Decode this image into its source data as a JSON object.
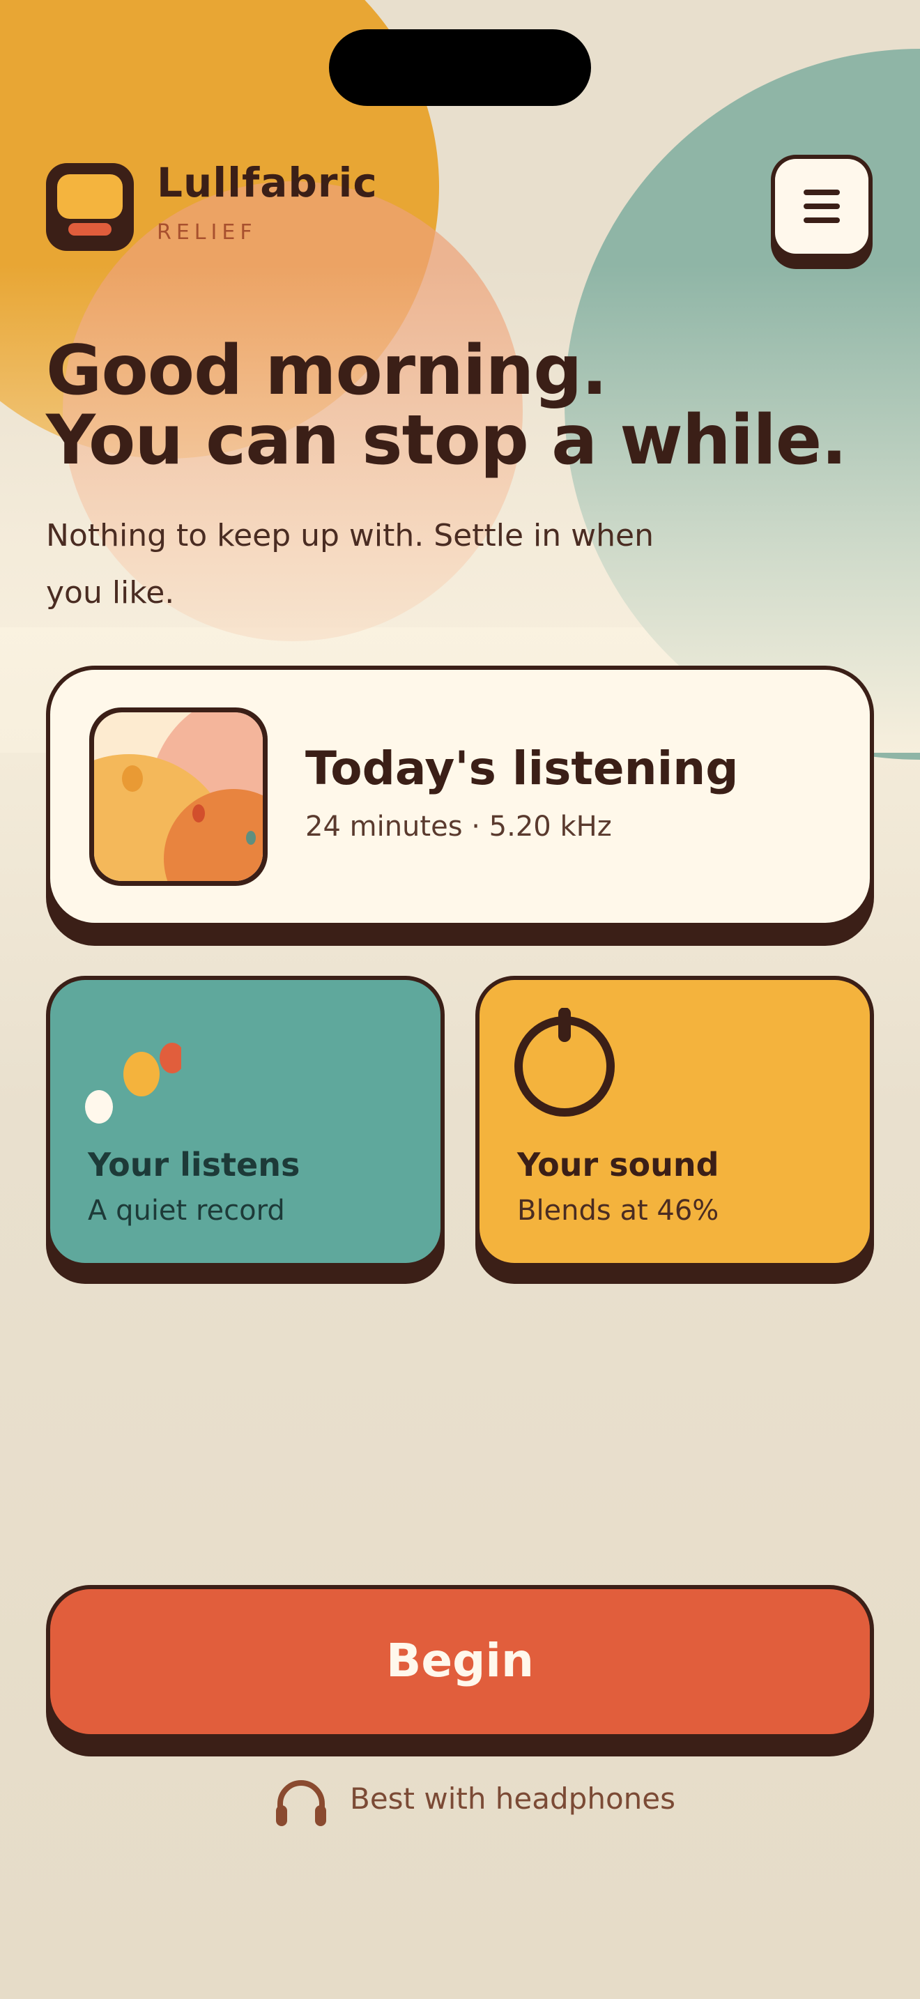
{
  "app": {
    "brand_name": "Lullfabric",
    "brand_subtitle": "RELIEF",
    "menu_icon": "hamburger-menu-icon"
  },
  "greeting": {
    "line1": "Good morning.",
    "line2": "You can stop a while.",
    "subtext": "Nothing to keep up with. Settle in when you like."
  },
  "today_card": {
    "title": "Today's listening",
    "meta": "24 minutes · 5.20 kHz"
  },
  "tiles": {
    "listens": {
      "title": "Your listens",
      "subtitle": "A quiet record",
      "icon": "dots-icon"
    },
    "sound": {
      "title": "Your sound",
      "subtitle": "Blends at 46%",
      "icon": "power-dial-icon"
    }
  },
  "primary_action": {
    "label": "Begin"
  },
  "hint": {
    "text": "Best with headphones",
    "icon": "headphones-icon"
  },
  "colors": {
    "background": "#e8dfcd",
    "ink": "#3b1f17",
    "cream": "#fff8ea",
    "teal": "#5fa89c",
    "gold": "#f4b33d",
    "coral": "#e15e3c"
  }
}
